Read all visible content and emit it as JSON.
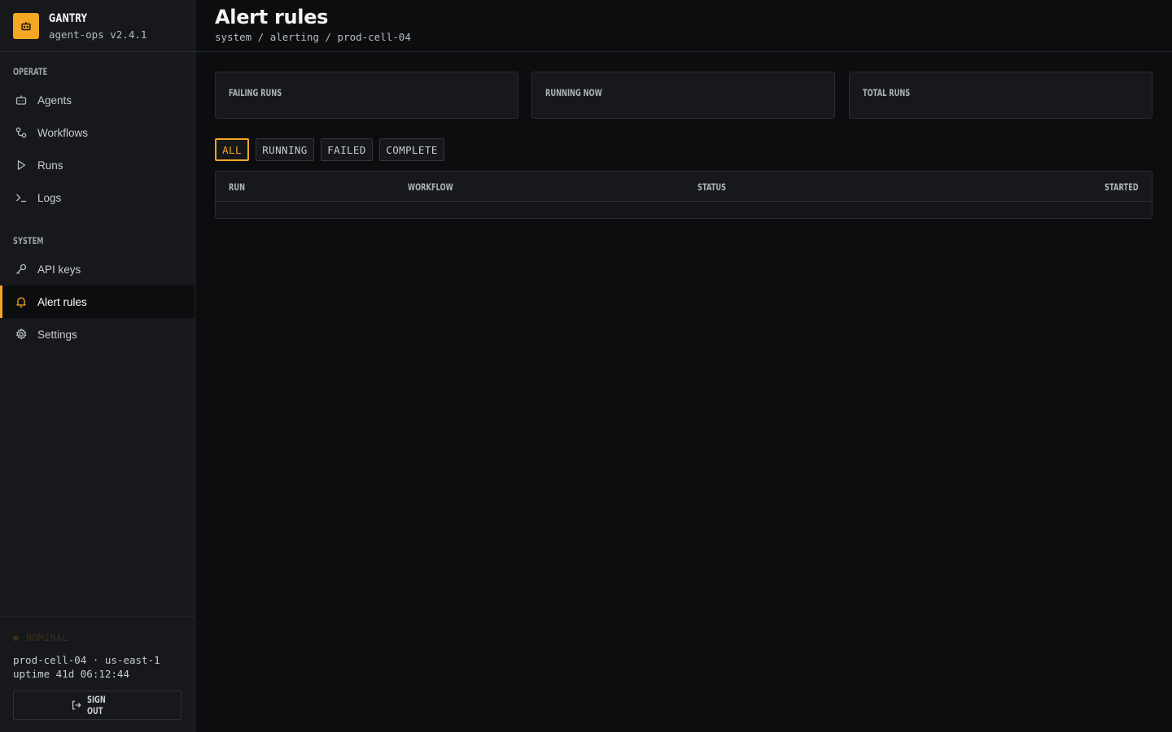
{
  "brand": {
    "name": "GANTRY",
    "version": "agent-ops v2.4.1",
    "logo_icon": "robot-icon",
    "accent": "#f5a623"
  },
  "sidebar": {
    "sections": [
      {
        "label": "OPERATE",
        "items": [
          {
            "label": "Agents",
            "icon": "robot-icon"
          },
          {
            "label": "Workflows",
            "icon": "workflow-icon"
          },
          {
            "label": "Runs",
            "icon": "play-icon"
          },
          {
            "label": "Logs",
            "icon": "terminal-icon"
          }
        ]
      },
      {
        "label": "SYSTEM",
        "items": [
          {
            "label": "API keys",
            "icon": "key-icon"
          },
          {
            "label": "Alert rules",
            "icon": "bell-icon",
            "active": true
          },
          {
            "label": "Settings",
            "icon": "gear-icon"
          }
        ]
      }
    ],
    "footer": {
      "status": "NOMINAL",
      "host": "prod-cell-04 · us-east-1",
      "uptime": "uptime 41d 06:12:44",
      "signout_label": "SIGN OUT"
    }
  },
  "header": {
    "title": "Alert rules",
    "breadcrumb": [
      "system",
      "alerting",
      "prod-cell-04"
    ],
    "separator": " / "
  },
  "stats": [
    {
      "label": "FAILING RUNS"
    },
    {
      "label": "RUNNING NOW"
    },
    {
      "label": "TOTAL RUNS"
    }
  ],
  "filters": [
    {
      "label": "ALL",
      "active": true
    },
    {
      "label": "RUNNING"
    },
    {
      "label": "FAILED"
    },
    {
      "label": "COMPLETE"
    }
  ],
  "table": {
    "columns": [
      "RUN",
      "WORKFLOW",
      "STATUS",
      "STARTED"
    ],
    "rows": []
  }
}
